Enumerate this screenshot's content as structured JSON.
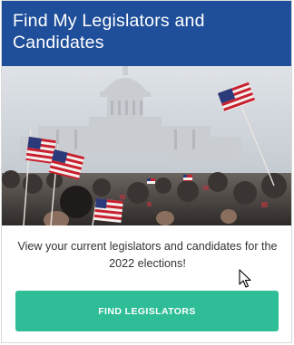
{
  "card": {
    "title": "Find My Legislators and Candidates",
    "image_alt": "US Capitol with crowd waving American flags",
    "description": "View your current legislators and candidates for the 2022 elections!",
    "button_label": "FIND LEGISLATORS"
  },
  "colors": {
    "header_bg": "#1f4f9a",
    "button_bg": "#2ebd97",
    "button_text": "#ffffff",
    "body_text": "#333333"
  },
  "icons": [
    "mouse-pointer-icon"
  ]
}
